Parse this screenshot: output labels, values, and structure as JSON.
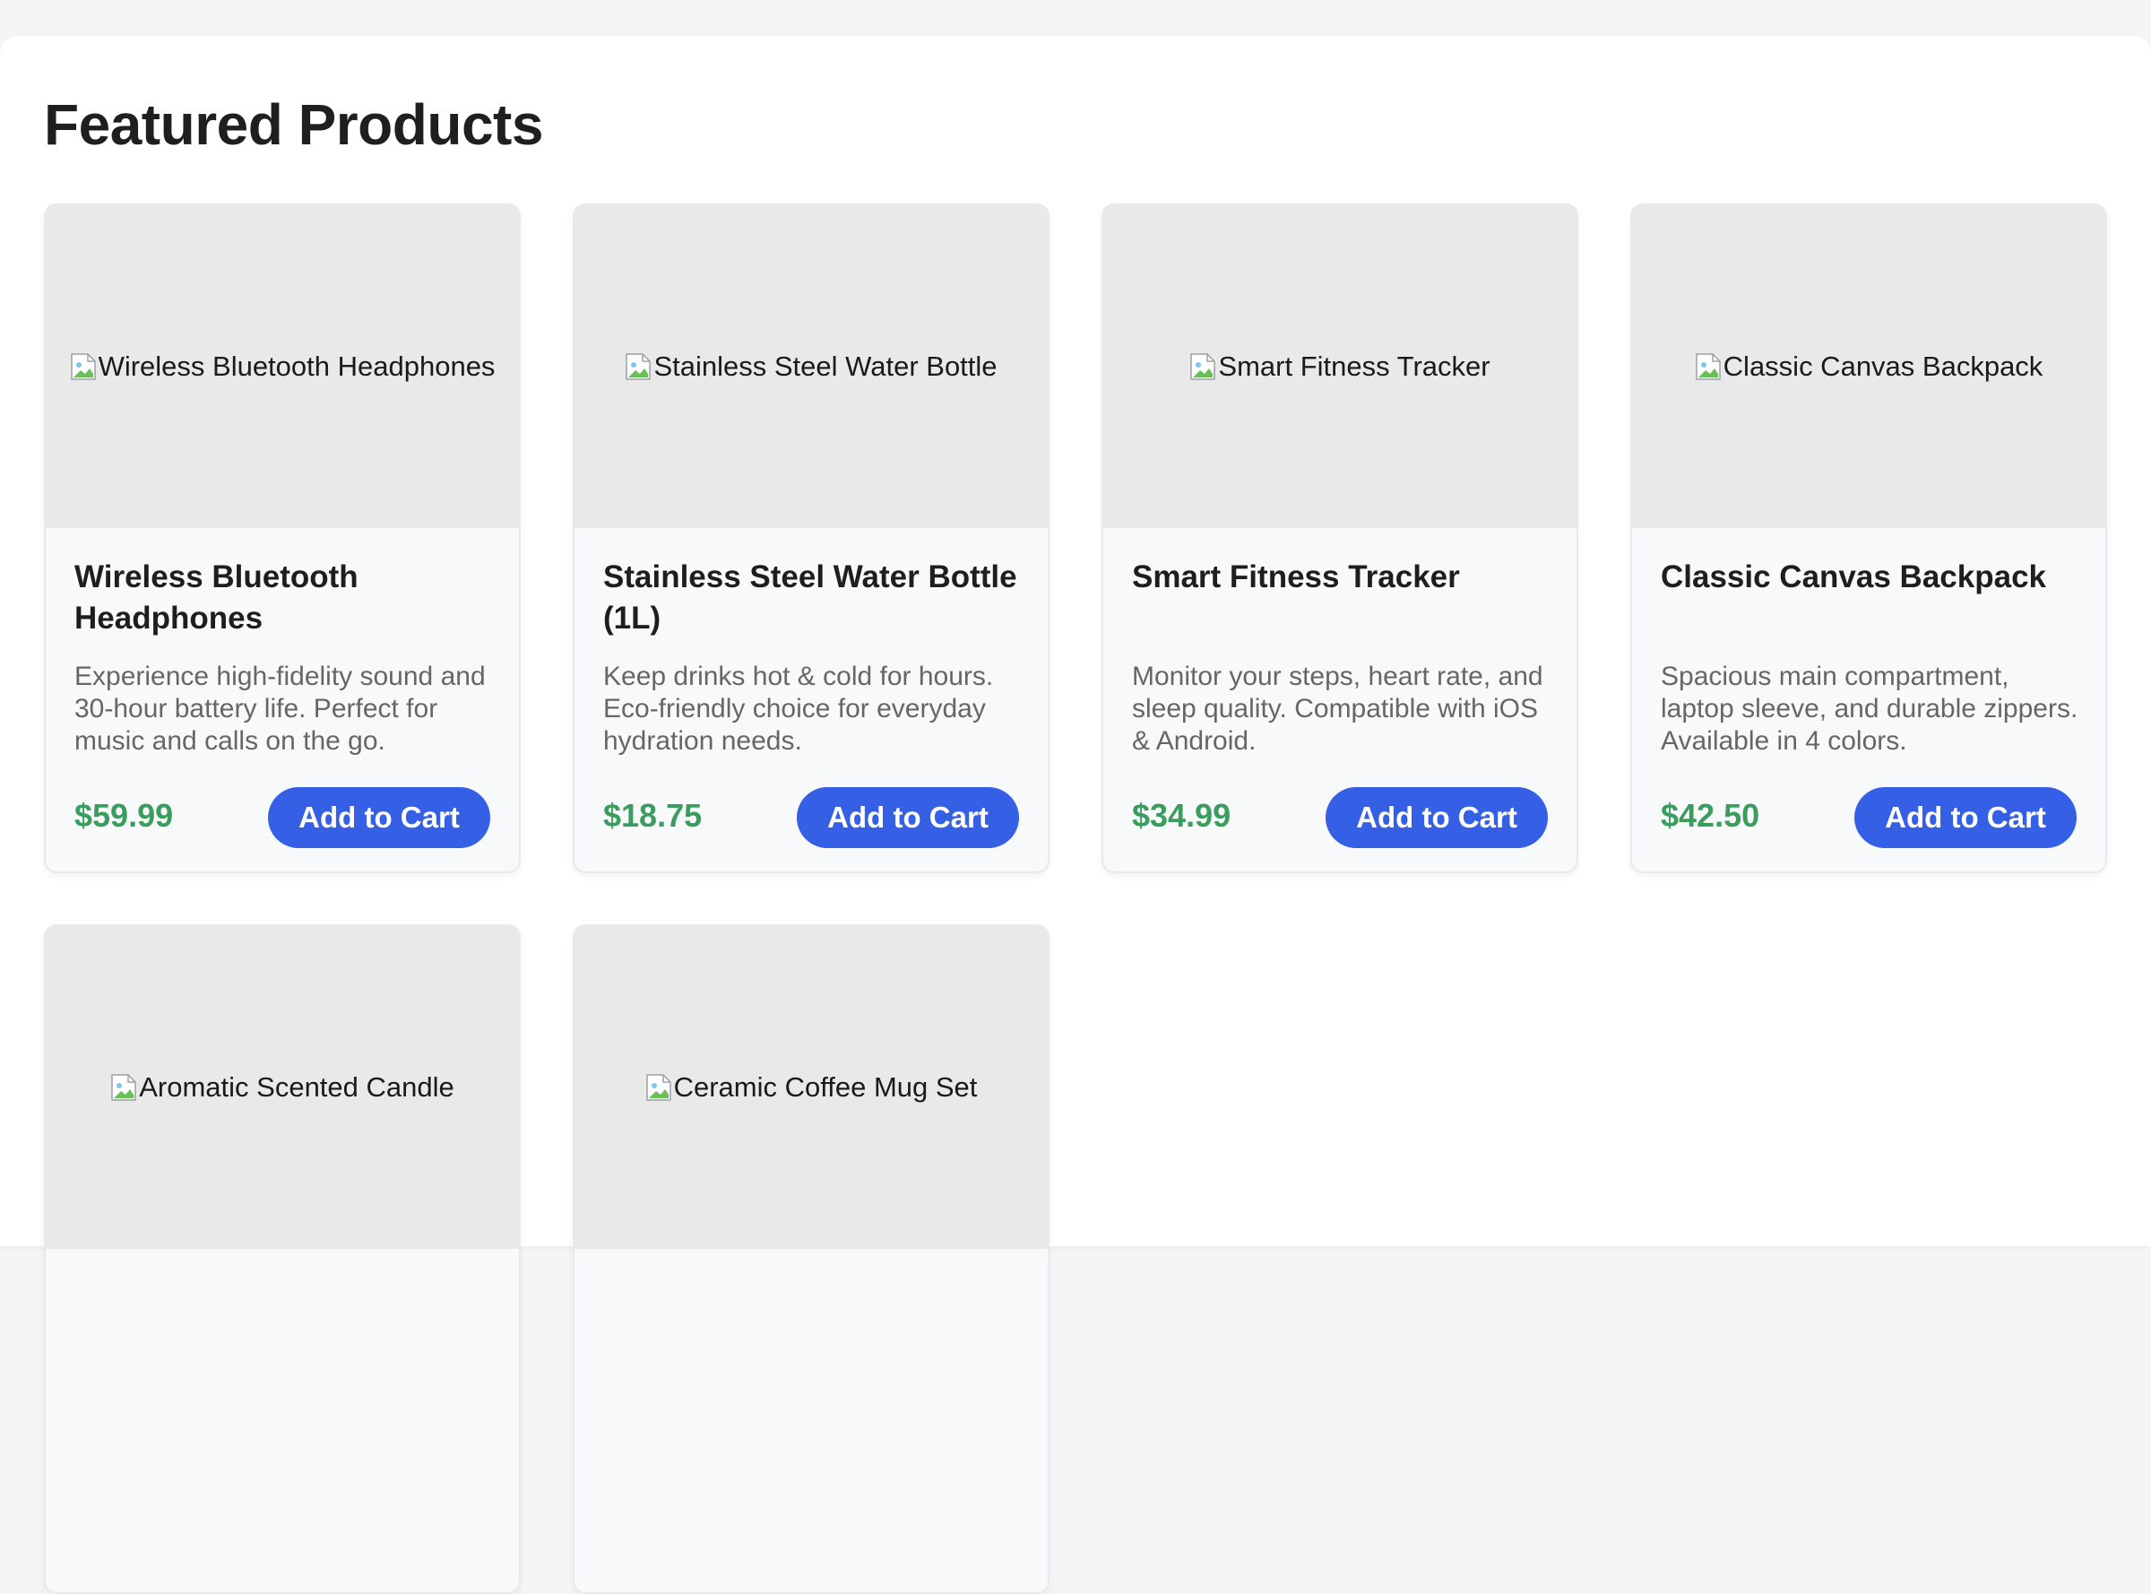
{
  "section": {
    "title": "Featured Products"
  },
  "products": [
    {
      "image_alt": "Wireless Bluetooth Headphones",
      "name": "Wireless Bluetooth Headphones",
      "description": "Experience high-fidelity sound and 30-hour battery life. Perfect for music and calls on the go.",
      "price": "$59.99",
      "cta": "Add to Cart"
    },
    {
      "image_alt": "Stainless Steel Water Bottle",
      "name": "Stainless Steel Water Bottle (1L)",
      "description": "Keep drinks hot & cold for hours. Eco-friendly choice for everyday hydration needs.",
      "price": "$18.75",
      "cta": "Add to Cart"
    },
    {
      "image_alt": "Smart Fitness Tracker",
      "name": "Smart Fitness Tracker",
      "description": "Monitor your steps, heart rate, and sleep quality. Compatible with iOS & Android.",
      "price": "$34.99",
      "cta": "Add to Cart"
    },
    {
      "image_alt": "Classic Canvas Backpack",
      "name": "Classic Canvas Backpack",
      "description": "Spacious main compartment, laptop sleeve, and durable zippers. Available in 4 colors.",
      "price": "$42.50",
      "cta": "Add to Cart"
    },
    {
      "image_alt": "Aromatic Scented Candle"
    },
    {
      "image_alt": "Ceramic Coffee Mug Set"
    }
  ],
  "colors": {
    "accent": "#3560e6",
    "price": "#3a9d5d",
    "page_background": "#f5f5f5",
    "card_background": "#f8f9fb",
    "image_placeholder": "#e9e9e9"
  },
  "icons": {
    "image_placeholder": "broken-image-icon"
  }
}
